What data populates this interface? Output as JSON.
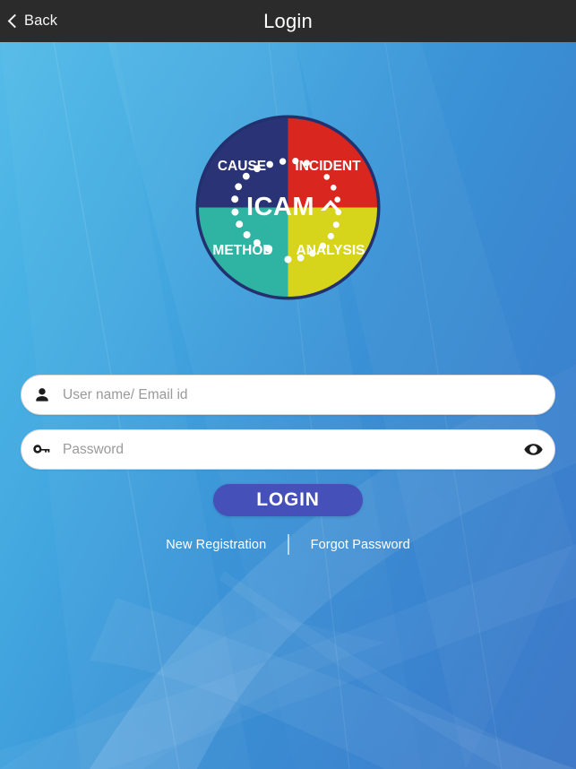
{
  "header": {
    "back_label": "Back",
    "back_icon": "chevron-left-icon",
    "title": "Login"
  },
  "logo": {
    "center_text": "ICAM",
    "caret_icon": "caret-up-icon",
    "quadrants": [
      {
        "label": "CAUSE",
        "color": "#2b3377",
        "position": "top-left"
      },
      {
        "label": "INCIDENT",
        "color": "#d9261f",
        "position": "top-right"
      },
      {
        "label": "METHOD",
        "color": "#2fb3a3",
        "position": "bottom-left"
      },
      {
        "label": "ANALYSIS",
        "color": "#d6d41b",
        "position": "bottom-right"
      }
    ],
    "ring_color": "#22306e",
    "dot_color": "#ffffff"
  },
  "form": {
    "username": {
      "placeholder": "User name/ Email id",
      "value": "",
      "icon": "person-icon"
    },
    "password": {
      "placeholder": "Password",
      "value": "",
      "icon": "key-icon",
      "toggle_icon": "eye-icon"
    },
    "login_label": "LOGIN",
    "login_color": "#4550b8"
  },
  "footer": {
    "new_registration_label": "New Registration",
    "forgot_password_label": "Forgot Password"
  },
  "theme": {
    "header_bg": "#2b2b2b",
    "bg_light": "#55bbe8",
    "bg_dark": "#3f79c7",
    "text_white": "#ffffff"
  }
}
